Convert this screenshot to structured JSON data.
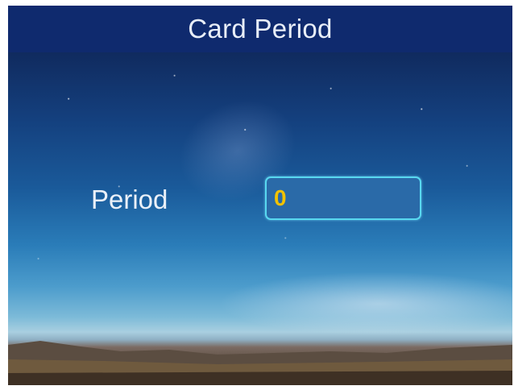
{
  "title": "Card Period",
  "form": {
    "period_label": "Period",
    "period_value": "0"
  },
  "colors": {
    "title_bar": "#0f2a6e",
    "input_border": "#58d8f0",
    "input_value": "#f2c200"
  }
}
